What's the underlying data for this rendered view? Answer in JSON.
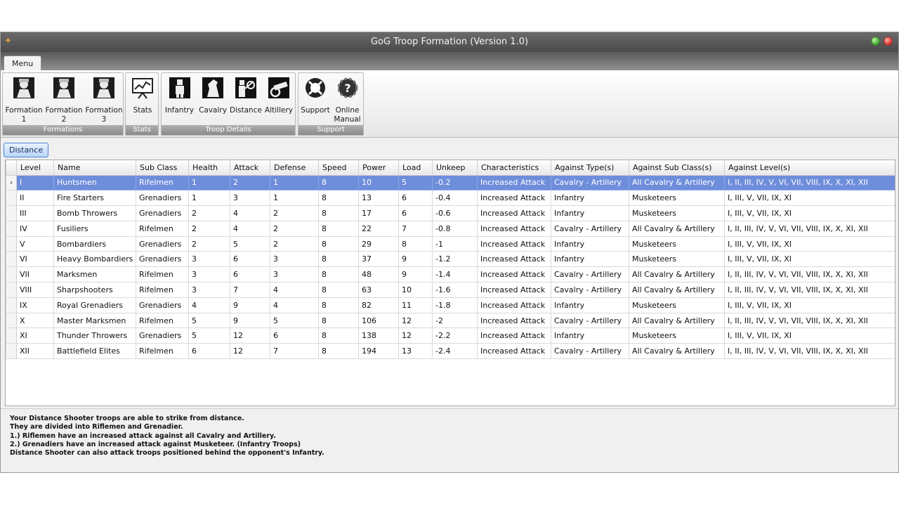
{
  "window": {
    "title": "GoG Troop Formation (Version 1.0)"
  },
  "menu_tab": "Menu",
  "ribbon": {
    "groups": [
      {
        "label": "Formations",
        "buttons": [
          "Formation\n1",
          "Formation\n2",
          "Formation\n3"
        ]
      },
      {
        "label": "Stats",
        "buttons": [
          "Stats"
        ]
      },
      {
        "label": "Troop Details",
        "buttons": [
          "Infantry",
          "Cavalry",
          "Distance",
          "Altillery"
        ]
      },
      {
        "label": "Support",
        "buttons": [
          "Support",
          "Online\nManual"
        ]
      }
    ]
  },
  "active_tab": "Distance",
  "table": {
    "selected_row": 0,
    "columns": [
      "Level",
      "Name",
      "Sub Class",
      "Health",
      "Attack",
      "Defense",
      "Speed",
      "Power",
      "Load",
      "Unkeep",
      "Characteristics",
      "Against Type(s)",
      "Against Sub Class(s)",
      "Against Level(s)"
    ],
    "rows": [
      [
        "I",
        "Huntsmen",
        "Rifelmen",
        "1",
        "2",
        "1",
        "8",
        "10",
        "5",
        "-0.2",
        "Increased Attack",
        "Cavalry - Artillery",
        "All Cavalry & Artillery",
        "I, II, III, IV, V, VI, VII, VIII, IX, X, XI, XII"
      ],
      [
        "II",
        "Fire Starters",
        "Grenadiers",
        "1",
        "3",
        "1",
        "8",
        "13",
        "6",
        "-0.4",
        "Increased Attack",
        "Infantry",
        "Musketeers",
        "I, III, V, VII, IX, XI"
      ],
      [
        "III",
        "Bomb Throwers",
        "Grenadiers",
        "2",
        "4",
        "2",
        "8",
        "17",
        "6",
        "-0.6",
        "Increased Attack",
        "Infantry",
        "Musketeers",
        "I, III, V, VII, IX, XI"
      ],
      [
        "IV",
        "Fusiliers",
        "Rifelmen",
        "2",
        "4",
        "2",
        "8",
        "22",
        "7",
        "-0.8",
        "Increased Attack",
        "Cavalry - Artillery",
        "All Cavalry & Artillery",
        "I, II, III, IV, V, VI, VII, VIII, IX, X, XI, XII"
      ],
      [
        "V",
        "Bombardiers",
        "Grenadiers",
        "2",
        "5",
        "2",
        "8",
        "29",
        "8",
        "-1",
        "Increased Attack",
        "Infantry",
        "Musketeers",
        "I, III, V, VII, IX, XI"
      ],
      [
        "VI",
        "Heavy Bombardiers",
        "Grenadiers",
        "3",
        "6",
        "3",
        "8",
        "37",
        "9",
        "-1.2",
        "Increased Attack",
        "Infantry",
        "Musketeers",
        "I, III, V, VII, IX, XI"
      ],
      [
        "VII",
        "Marksmen",
        "Rifelmen",
        "3",
        "6",
        "3",
        "8",
        "48",
        "9",
        "-1.4",
        "Increased Attack",
        "Cavalry - Artillery",
        "All Cavalry & Artillery",
        "I, II, III, IV, V, VI, VII, VIII, IX, X, XI, XII"
      ],
      [
        "VIII",
        "Sharpshooters",
        "Rifelmen",
        "3",
        "7",
        "4",
        "8",
        "63",
        "10",
        "-1.6",
        "Increased Attack",
        "Cavalry - Artillery",
        "All Cavalry & Artillery",
        "I, II, III, IV, V, VI, VII, VIII, IX, X, XI, XII"
      ],
      [
        "IX",
        "Royal Grenadiers",
        "Grenadiers",
        "4",
        "9",
        "4",
        "8",
        "82",
        "11",
        "-1.8",
        "Increased Attack",
        "Infantry",
        "Musketeers",
        "I, III, V, VII, IX, XI"
      ],
      [
        "X",
        "Master Marksmen",
        "Rifelmen",
        "5",
        "9",
        "5",
        "8",
        "106",
        "12",
        "-2",
        "Increased Attack",
        "Cavalry - Artillery",
        "All Cavalry & Artillery",
        "I, II, III, IV, V, VI, VII, VIII, IX, X, XI, XII"
      ],
      [
        "XI",
        "Thunder Throwers",
        "Grenadiers",
        "5",
        "12",
        "6",
        "8",
        "138",
        "12",
        "-2.2",
        "Increased Attack",
        "Infantry",
        "Musketeers",
        "I, III, V, VII, IX, XI"
      ],
      [
        "XII",
        "Battlefield Elites",
        "Rifelmen",
        "6",
        "12",
        "7",
        "8",
        "194",
        "13",
        "-2.4",
        "Increased Attack",
        "Cavalry - Artillery",
        "All Cavalry & Artillery",
        "I, II, III, IV, V, VI, VII, VIII, IX, X, XI, XII"
      ]
    ]
  },
  "notes": [
    "Your Distance Shooter troops are able to strike from distance.",
    "They are divided into Riflemen and Grenadier.",
    "1.) Riflemen have an increased attack against all Cavalry and Artillery.",
    "2.) Grenadiers have an increased attack against Musketeer. (Infantry Troops)",
    "Distance Shooter can also attack troops positioned behind the opponent's Infantry."
  ],
  "colors": {
    "selection": "#6e8edb",
    "titlebar": "#5a5a5a",
    "tab_accent": "#4f82cf"
  },
  "icons": [
    "troop-portrait-icon",
    "stats-chart-icon",
    "infantry-icon",
    "cavalry-icon",
    "distance-icon",
    "artillery-icon",
    "support-lifebuoy-icon",
    "online-manual-icon",
    "row-indicator-icon"
  ]
}
